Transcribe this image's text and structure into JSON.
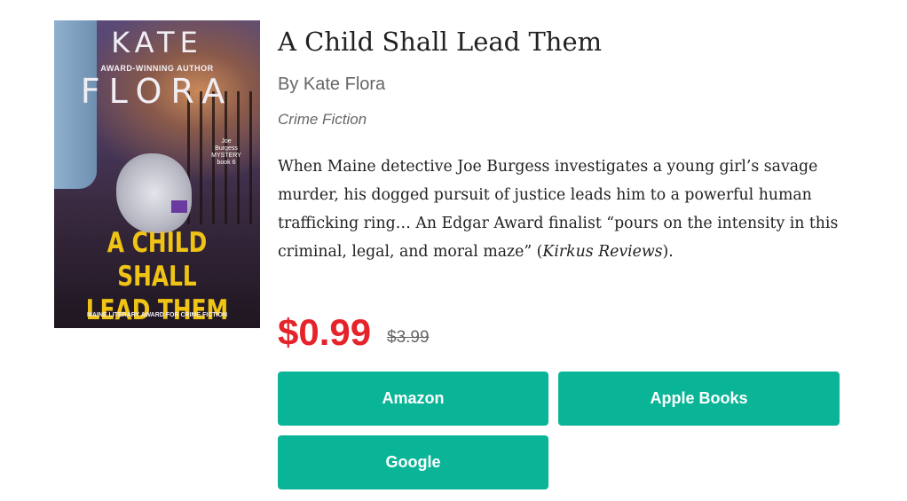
{
  "book": {
    "cover": {
      "author_first": "KATE",
      "tagline": "AWARD-WINNING AUTHOR",
      "author_last": "FLORA",
      "series": [
        "Joe",
        "Burgess",
        "MYSTERY",
        "book 6"
      ],
      "title_lines": [
        "A CHILD SHALL",
        "LEAD THEM"
      ],
      "award": "MAINE LITERARY AWARD FOR CRIME FICTION"
    },
    "title": "A Child Shall Lead Them",
    "author": "By Kate Flora",
    "genre": "Crime Fiction",
    "description": {
      "main": "When Maine detective Joe Burgess investigates a young girl’s savage murder, his dogged pursuit of justice leads him to a powerful human trafficking ring… An Edgar Award finalist “pours on the intensity in this criminal, legal, and moral maze” (",
      "source": "Kirkus Reviews",
      "end": ")."
    },
    "price": "$0.99",
    "original_price": "$3.99"
  },
  "buttons": {
    "amazon": "Amazon",
    "apple": "Apple Books",
    "google": "Google"
  },
  "colors": {
    "accent_button": "#0ab597",
    "sale_price": "#e5232b"
  }
}
